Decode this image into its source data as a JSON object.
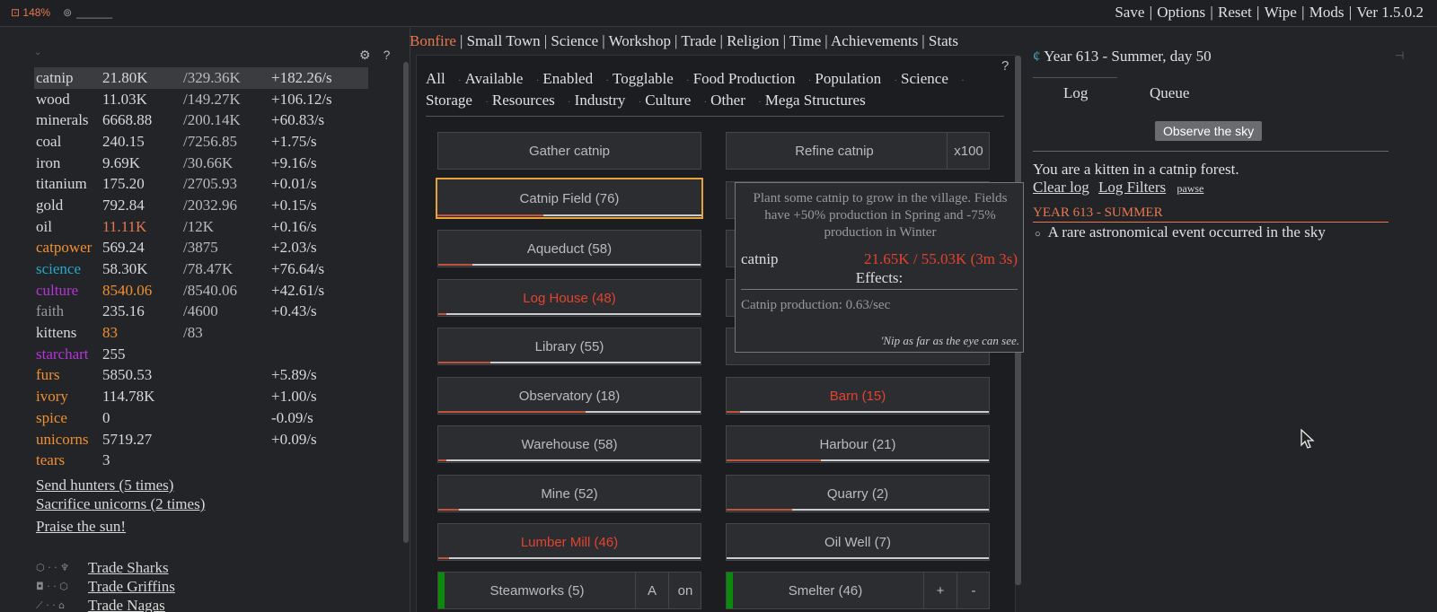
{
  "topbar": {
    "zoom": "148%",
    "user": "______",
    "menu": [
      "Save",
      "Options",
      "Reset",
      "Wipe",
      "Mods",
      "Ver 1.5.0.2"
    ]
  },
  "resources": [
    {
      "name": "catnip",
      "value": "21.80K",
      "max": "/329.36K",
      "rate": "+182.26/s",
      "color": "#d8d8d8",
      "vcolor": "#d8d8d8"
    },
    {
      "name": "wood",
      "value": "11.03K",
      "max": "/149.27K",
      "rate": "+106.12/s",
      "color": "#d8d8d8",
      "vcolor": "#d8d8d8"
    },
    {
      "name": "minerals",
      "value": "6668.88",
      "max": "/200.14K",
      "rate": "+60.83/s",
      "color": "#d8d8d8",
      "vcolor": "#d8d8d8"
    },
    {
      "name": "coal",
      "value": "240.15",
      "max": "/7256.85",
      "rate": "+1.75/s",
      "color": "#d8d8d8",
      "vcolor": "#d8d8d8"
    },
    {
      "name": "iron",
      "value": "9.69K",
      "max": "/30.66K",
      "rate": "+9.16/s",
      "color": "#d8d8d8",
      "vcolor": "#d8d8d8"
    },
    {
      "name": "titanium",
      "value": "175.20",
      "max": "/2705.93",
      "rate": "+0.01/s",
      "color": "#d8d8d8",
      "vcolor": "#d8d8d8"
    },
    {
      "name": "gold",
      "value": "792.84",
      "max": "/2032.96",
      "rate": "+0.15/s",
      "color": "#d8d8d8",
      "vcolor": "#d8d8d8"
    },
    {
      "name": "oil",
      "value": "11.11K",
      "max": "/12K",
      "rate": "+0.16/s",
      "color": "#d8d8d8",
      "vcolor": "#e8774f"
    },
    {
      "name": "catpower",
      "value": "569.24",
      "max": "/3875",
      "rate": "+2.03/s",
      "color": "#f09030",
      "vcolor": "#d8d8d8"
    },
    {
      "name": "science",
      "value": "58.30K",
      "max": "/78.47K",
      "rate": "+76.64/s",
      "color": "#22aacc",
      "vcolor": "#d8d8d8"
    },
    {
      "name": "culture",
      "value": "8540.06",
      "max": "/8540.06",
      "rate": "+42.61/s",
      "color": "#b535d8",
      "vcolor": "#f09030"
    },
    {
      "name": "faith",
      "value": "235.16",
      "max": "/4600",
      "rate": "+0.43/s",
      "color": "#999999",
      "vcolor": "#d8d8d8"
    },
    {
      "name": "kittens",
      "value": "83",
      "max": "/83",
      "rate": "",
      "color": "#d8d8d8",
      "vcolor": "#f09030"
    },
    {
      "name": "starchart",
      "value": "255",
      "max": "",
      "rate": "",
      "color": "#b535d8",
      "vcolor": "#d8d8d8"
    },
    {
      "name": "furs",
      "value": "5850.53",
      "max": "",
      "rate": "+5.89/s",
      "color": "#f09030",
      "vcolor": "#d8d8d8"
    },
    {
      "name": "ivory",
      "value": "114.78K",
      "max": "",
      "rate": "+1.00/s",
      "color": "#f09030",
      "vcolor": "#d8d8d8"
    },
    {
      "name": "spice",
      "value": "0",
      "max": "",
      "rate": "-0.09/s",
      "color": "#f09030",
      "vcolor": "#d8d8d8"
    },
    {
      "name": "unicorns",
      "value": "5719.27",
      "max": "",
      "rate": "+0.09/s",
      "color": "#f09030",
      "vcolor": "#d8d8d8"
    },
    {
      "name": "tears",
      "value": "3",
      "max": "",
      "rate": "",
      "color": "#f09030",
      "vcolor": "#d8d8d8"
    }
  ],
  "actions": {
    "send_hunters": "Send hunters (5 times)",
    "sacrifice": "Sacrifice unicorns (2 times)",
    "praise": "Praise the sun!"
  },
  "trades": [
    "Trade Sharks",
    "Trade Griffins",
    "Trade Nagas"
  ],
  "tabs": [
    "Bonfire",
    "Small Town",
    "Science",
    "Workshop",
    "Trade",
    "Religion",
    "Time",
    "Achievements",
    "Stats"
  ],
  "filters": [
    "All",
    "Available",
    "Enabled",
    "Togglable",
    "Food Production",
    "Population",
    "Science",
    "Storage",
    "Resources",
    "Industry",
    "Culture",
    "Other",
    "Mega Structures"
  ],
  "buttons": {
    "gather": "Gather catnip",
    "refine": "Refine catnip",
    "refine_x": "x100",
    "catnip_field": "Catnip Field (76)",
    "aqueduct": "Aqueduct (58)",
    "log_house": "Log House (48)",
    "library": "Library (55)",
    "observatory": "Observatory (18)",
    "barn": "Barn (15)",
    "warehouse": "Warehouse (58)",
    "harbour": "Harbour (21)",
    "mine": "Mine (52)",
    "quarry": "Quarry (2)",
    "lumber_mill": "Lumber Mill (46)",
    "oil_well": "Oil Well (7)",
    "steamworks": "Steamworks (5)",
    "steam_a": "A",
    "steam_on": "on",
    "smelter": "Smelter (46)",
    "plus": "+",
    "minus": "-"
  },
  "progress": {
    "catnip_field": 0.4,
    "aqueduct": 0.13,
    "log_house": 0.03,
    "library": 0.2,
    "observatory": 0.56,
    "barn": 0.05,
    "warehouse": 0.03,
    "harbour": 0.36,
    "mine": 0.08,
    "quarry": 0.25,
    "lumber_mill": 0.04,
    "oil_well": 0.0
  },
  "tooltip": {
    "description": "Plant some catnip to grow in the village. Fields have +50% production in Spring and -75% production in Winter",
    "resource": "catnip",
    "resource_value": "21.65K / 55.03K (3m 3s)",
    "effects_label": "Effects:",
    "effect": "Catnip production: 0.63/sec",
    "flavor": "'Nip as far as the eye can see."
  },
  "right": {
    "year": "Year 613 - Summer, day 50",
    "log_tab": "Log",
    "queue_tab": "Queue",
    "observe": "Observe the sky",
    "intro": "You are a kitten in a catnip forest.",
    "clear_log": "Clear log",
    "log_filters": "Log Filters",
    "pawse": "pawse",
    "year_head": "YEAR 613 - SUMMER",
    "event": "A rare astronomical event occurred in the sky"
  },
  "colors": {
    "accent": "#e8774f",
    "red": "#e3432e",
    "highlight": "#e8a23a",
    "green": "#0b8a0b"
  }
}
